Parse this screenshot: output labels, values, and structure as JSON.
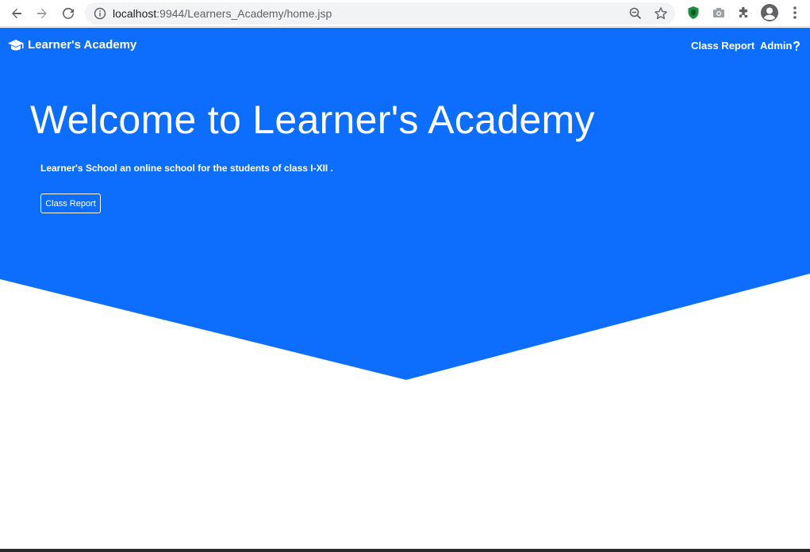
{
  "browser": {
    "url_host": "localhost",
    "url_port_path": ":9944/Learners_Academy/home.jsp",
    "icons": [
      "back-arrow-icon",
      "forward-arrow-icon",
      "reload-icon",
      "info-icon",
      "zoom-out-icon",
      "star-icon",
      "shield-extension-icon",
      "camera-icon",
      "puzzle-extensions-icon",
      "profile-avatar-icon",
      "more-menu-icon"
    ]
  },
  "navbar": {
    "brand": "Learner's Academy",
    "brand_icon": "graduation-cap-icon",
    "links": [
      {
        "label": "Class Report"
      },
      {
        "label": "Admin"
      }
    ],
    "help_icon": "question-mark-icon"
  },
  "hero": {
    "title": "Welcome to Learner's Academy",
    "subtitle": "Learner's School an online school for the students of class I-XII .",
    "button_label": "Class Report"
  },
  "colors": {
    "primary": "#0d6efd",
    "text_on_primary": "#ffffff",
    "page_bg": "#ffffff"
  }
}
